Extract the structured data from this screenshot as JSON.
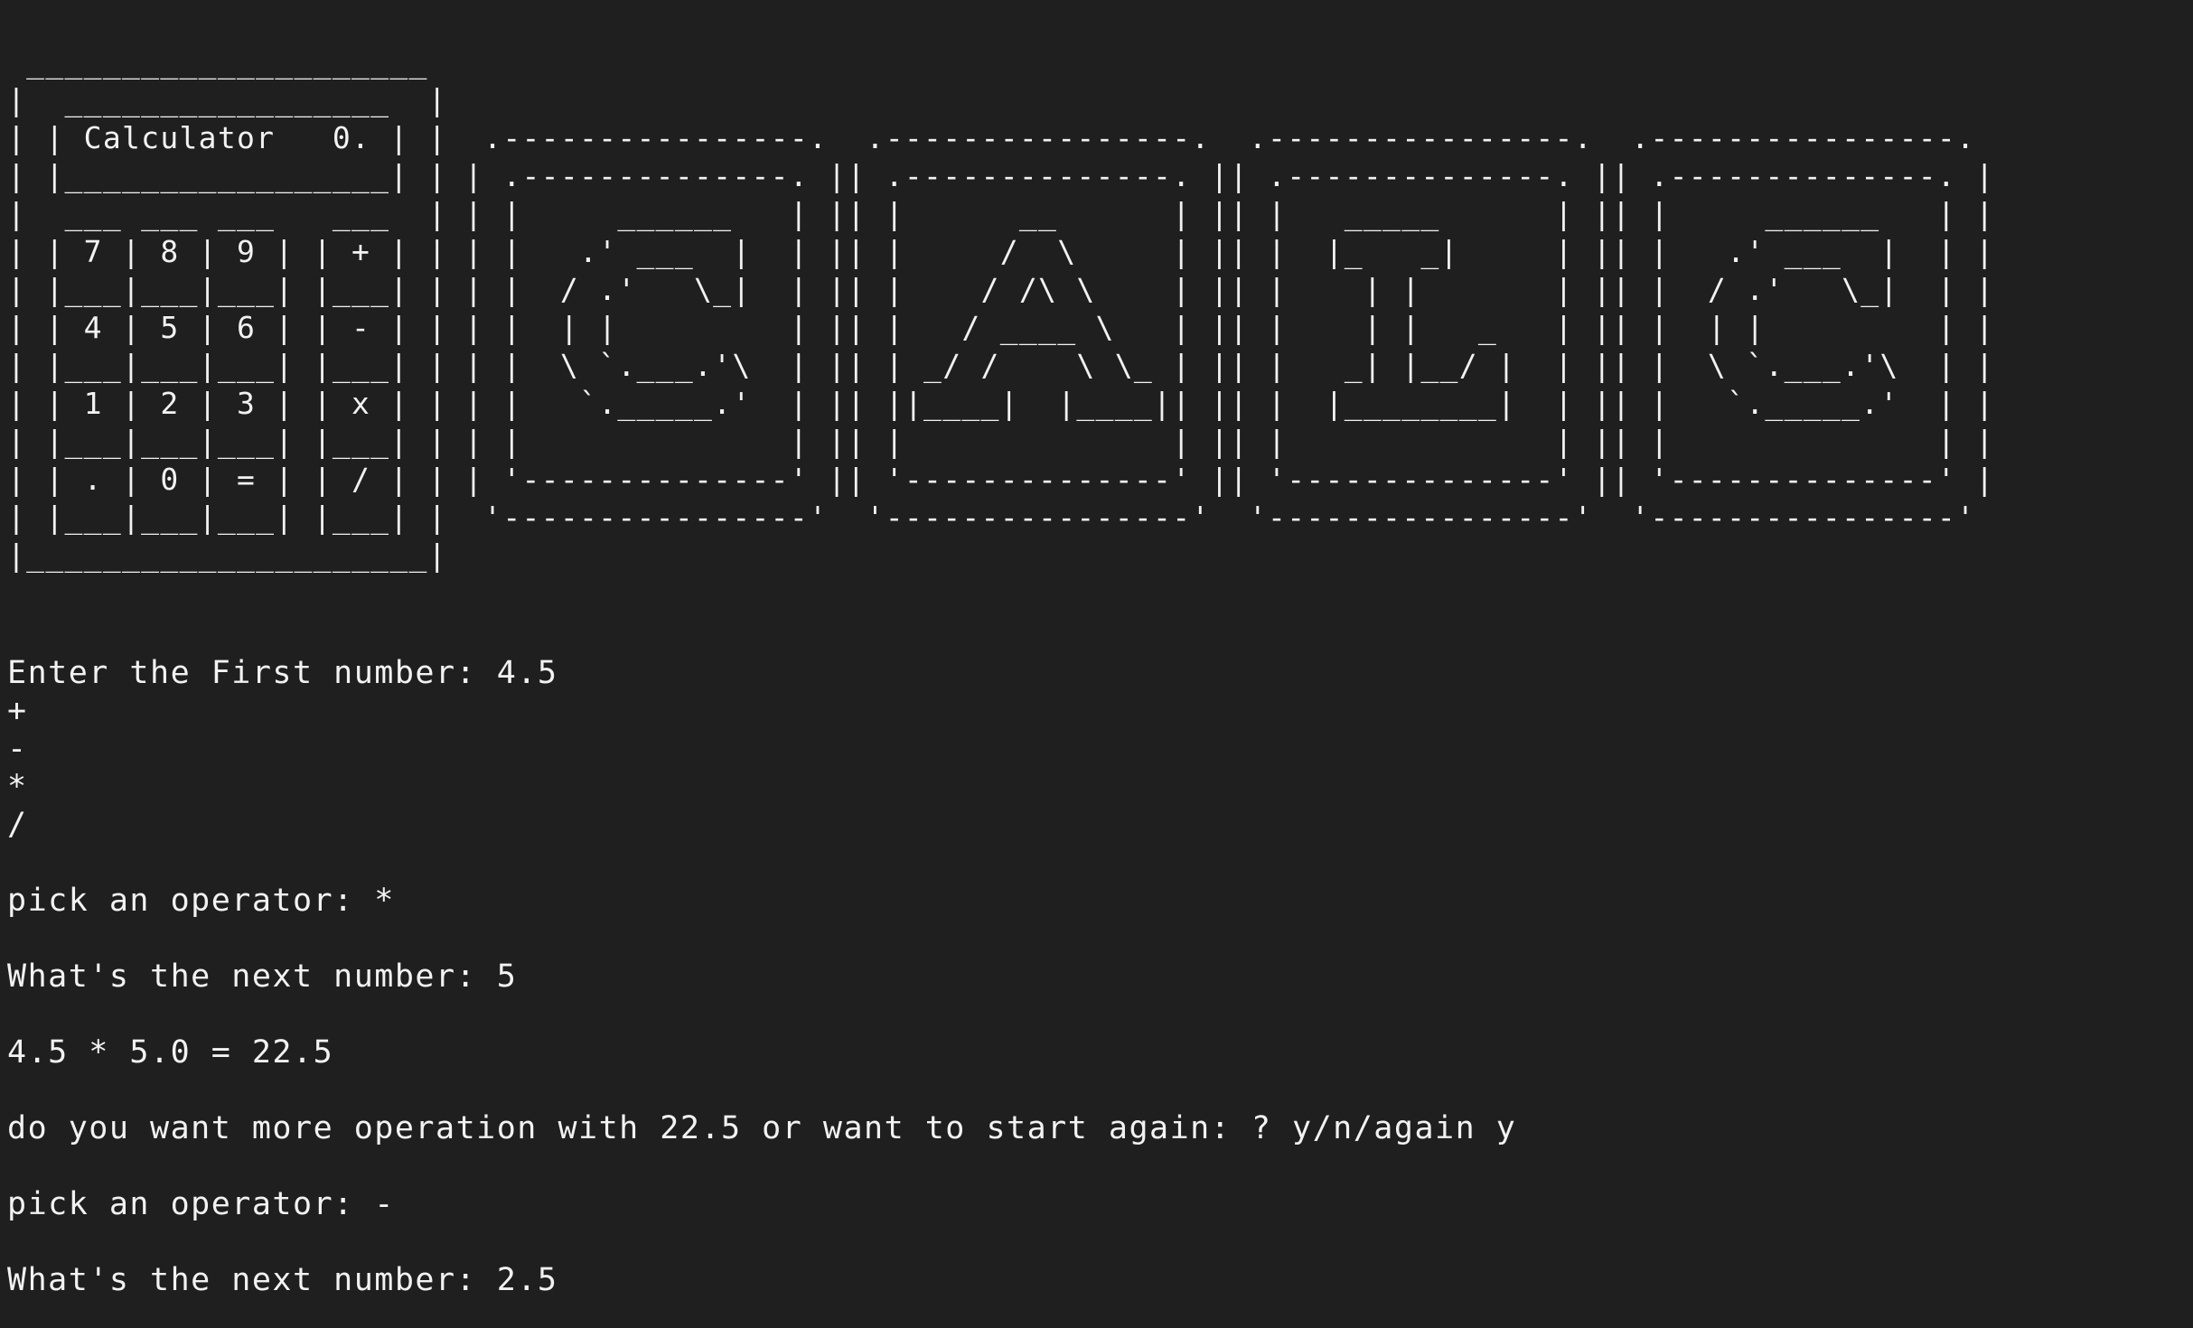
{
  "ascii_art": {
    "calculator": " _____________________\n|  _________________  |\n| | Calculator   0. | |\n| |_________________| |\n|  ___ ___ ___   ___  |\n| | 7 | 8 | 9 | | + | |\n| |___|___|___| |___| |\n| | 4 | 5 | 6 | | - | |\n| |___|___|___| |___| |\n| | 1 | 2 | 3 | | x | |\n| |___|___|___| |___| |\n| | . | 0 | = | | / | |\n| |___|___|___| |___| |\n|_____________________|",
    "banner": " .----------------.  .----------------.  .----------------.  .----------------. \n| .--------------. || .--------------. || .--------------. || .--------------. |\n| |     ______   | || |      __      | || |   _____      | || |     ______   | |\n| |   .' ___  |  | || |     /  \\     | || |  |_   _|     | || |   .' ___  |  | |\n| |  / .'   \\_|  | || |    / /\\ \\    | || |    | |       | || |  / .'   \\_|  | |\n| |  | |         | || |   / ____ \\   | || |    | |   _   | || |  | |         | |\n| |  \\ `.___.'\\  | || | _/ /    \\ \\_ | || |   _| |__/ |  | || |  \\ `.___.'\\  | |\n| |   `._____.'  | || ||____|  |____|| || |  |________|  | || |   `._____.'  | |\n| |              | || |              | || |              | || |              | |\n| '--------------' || '--------------' || '--------------' || '--------------' |\n '----------------'  '----------------'  '----------------'  '----------------' "
  },
  "transcript": {
    "first_prompt": "Enter the First number: 4.5",
    "operators": [
      "+",
      "-",
      "*",
      "/"
    ],
    "operator_prompt_1": "pick an operator: *",
    "next_number_prompt_1": "What's the next number: 5",
    "result_line": "4.5 * 5.0 = 22.5",
    "continue_prompt": "do you want more operation with 22.5 or want to start again: ? y/n/again y",
    "operator_prompt_2": "pick an operator: -",
    "next_number_prompt_2": "What's the next number: 2.5"
  }
}
